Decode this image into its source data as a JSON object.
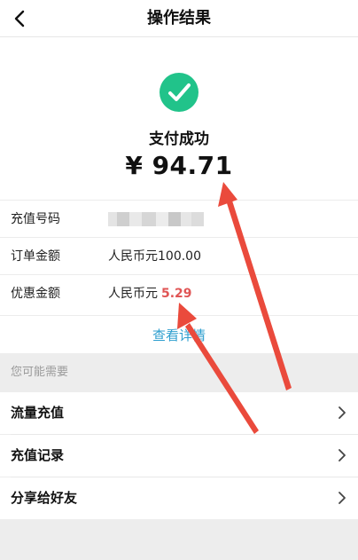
{
  "nav": {
    "title": "操作结果",
    "back_icon": "chevron-left-icon"
  },
  "result": {
    "icon": "check-circle-icon",
    "status": "支付成功",
    "amount": "¥ 94.71",
    "accent_color": "#21c38a"
  },
  "details": {
    "recharge_number": {
      "label": "充值号码"
    },
    "order_amount": {
      "label": "订单金额",
      "value": "人民币元100.00"
    },
    "discount": {
      "label": "优惠金额",
      "value_prefix": "人民币元",
      "value_number": "5.29",
      "number_color": "#e05555"
    }
  },
  "detail_link": "查看详情",
  "section_header": "您可能需要",
  "list": [
    {
      "label": "流量充值"
    },
    {
      "label": "充值记录"
    },
    {
      "label": "分享给好友"
    }
  ],
  "annotation_color": "#ea4a3c"
}
